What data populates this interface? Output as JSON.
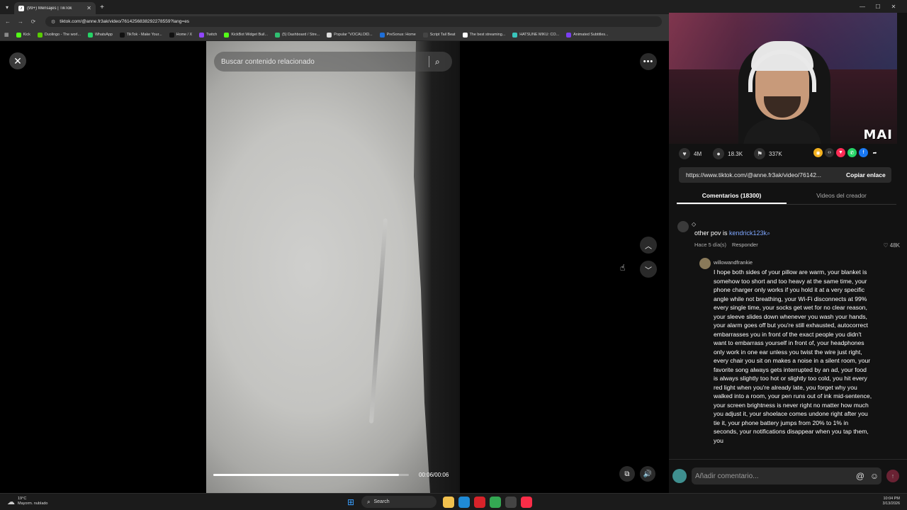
{
  "browser": {
    "tab_title": "(99+) Mensajes | TikTok",
    "tab_favicon": "tiktok-icon",
    "url": "tiktok.com/@anne.fr3ak/video/7614256838292278559?lang=es",
    "bookmarks": [
      {
        "label": "Kick",
        "color": "#53fc18"
      },
      {
        "label": "Duolingo - The worl...",
        "color": "#58cc02"
      },
      {
        "label": "WhatsApp",
        "color": "#25d366"
      },
      {
        "label": "TikTok - Make Your...",
        "color": "#111111"
      },
      {
        "label": "Home / X",
        "color": "#111111"
      },
      {
        "label": "Twitch",
        "color": "#9146ff"
      },
      {
        "label": "KickBot Widget Buil...",
        "color": "#53fc18"
      },
      {
        "label": "(5) Dashboard / Stre...",
        "color": "#2fbf71"
      },
      {
        "label": "Popular \"VOCALOID...",
        "color": "#dddddd"
      },
      {
        "label": "PreSonus: Home",
        "color": "#1e6fd9"
      },
      {
        "label": "Script Tail Beat",
        "color": "#444444"
      },
      {
        "label": "The best streaming...",
        "color": "#ffffff"
      },
      {
        "label": "HATSUNE MIKU: CO...",
        "color": "#39c5bb"
      },
      {
        "label": "Animated Subtitles...",
        "color": "#7b3ff2"
      }
    ]
  },
  "player": {
    "search_placeholder": "Buscar contenido relacionado",
    "time": "00:06/00:06",
    "progress": 0.95
  },
  "panel": {
    "overlay_text": "MAI",
    "stats": {
      "likes": "4M",
      "comments": "18.3K",
      "saves": "337K"
    },
    "share_icons": [
      {
        "name": "coin-icon",
        "color": "#f2b01e",
        "glyph": "◉"
      },
      {
        "name": "embed-icon",
        "color": "#2f2f2f",
        "glyph": "‹›"
      },
      {
        "name": "send-icon",
        "color": "#fe2c55",
        "glyph": "▼"
      },
      {
        "name": "whatsapp-icon",
        "color": "#25d366",
        "glyph": "✆"
      },
      {
        "name": "facebook-icon",
        "color": "#1877f2",
        "glyph": "f"
      },
      {
        "name": "share-arrow-icon",
        "color": "#121212",
        "glyph": "➦"
      }
    ],
    "link": "https://www.tiktok.com/@anne.fr3ak/video/76142...",
    "copy_label": "Copiar enlace",
    "tab_comments": "Comentarios (18300)",
    "tab_creator": "Videos del creador"
  },
  "comments": {
    "first": {
      "mark": "◇",
      "text": "other pov is ",
      "mention": "kendrick123k",
      "meta": "Hace 5 día(s)",
      "reply_label": "Responder",
      "likes": "48K"
    },
    "reply": {
      "user": "willowandfrankie",
      "text": "I hope both sides of your pillow are warm, your blanket is somehow too short and too heavy at the same time, your phone charger only works if you hold it at a very specific angle while not breathing, your Wi-Fi disconnects at 99% every single time, your socks get wet for no clear reason, your sleeve slides down whenever you wash your hands, your alarm goes off but you're still exhausted, autocorrect embarrasses you in front of the exact people you didn't want to embarrass yourself in front of, your headphones only work in one ear unless you twist the wire just right, every chair you sit on makes a noise in a silent room, your favorite song always gets interrupted by an ad, your food is always slightly too hot or slightly too cold, you hit every red light when you're already late, you forget why you walked into a room, your pen runs out of ink mid-sentence, your screen brightness is never right no matter how much you adjust it, your shoelace comes undone right after you tie it, your phone battery jumps from 20% to 1% in seconds, your notifications disappear when you tap them, you"
    },
    "input_placeholder": "Añadir comentario..."
  },
  "taskbar": {
    "temp": "19°C",
    "weather": "Mayorm. nublado",
    "search_label": "Search",
    "time": "10:04 PM",
    "date": "3/13/2026",
    "apps": [
      {
        "name": "file-explorer-icon",
        "color": "#f2c14e"
      },
      {
        "name": "edge-icon",
        "color": "#1f8ad6"
      },
      {
        "name": "opera-icon",
        "color": "#d8232a"
      },
      {
        "name": "chrome-icon",
        "color": "#34a853"
      },
      {
        "name": "chatgpt-icon",
        "color": "#444444"
      },
      {
        "name": "music-icon",
        "color": "#fa2d48"
      }
    ]
  }
}
